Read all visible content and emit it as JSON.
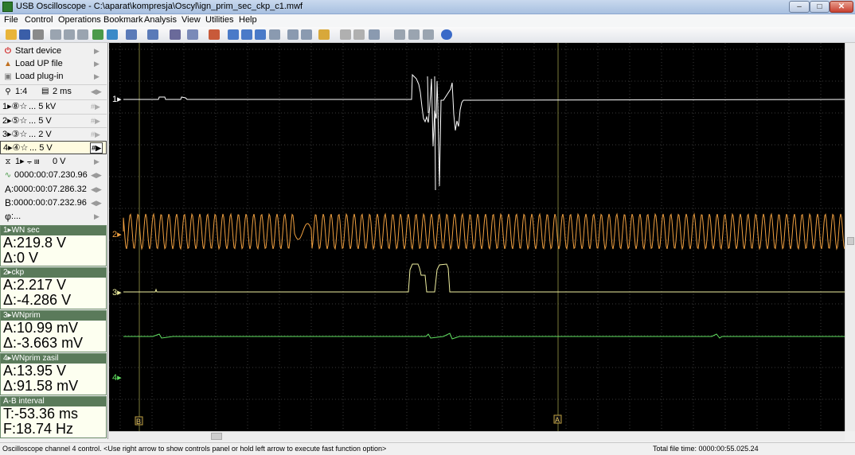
{
  "window": {
    "title": "USB Oscilloscope - C:\\aparat\\kompresja\\Oscyl\\ign_prim_sec_ckp_c1.mwf"
  },
  "menu": [
    "File",
    "Control",
    "Operations",
    "Bookmark",
    "Analysis",
    "View",
    "Utilities",
    "Help"
  ],
  "left_panel": {
    "start_device": "Start device",
    "load_up_file": "Load UP file",
    "load_plugin": "Load plug-in",
    "zoom": "1:4",
    "timebase": "2 ms",
    "channels": [
      {
        "num": "1",
        "label": "... 5 kV"
      },
      {
        "num": "2",
        "label": "... 5 V"
      },
      {
        "num": "3",
        "label": "... 2 V"
      },
      {
        "num": "4",
        "label": "... 5 V"
      }
    ],
    "trigger": "1",
    "trigger_level": "0 V",
    "time": "0000:00:07.230.96",
    "cursor_a": "0000:00:07.286.32",
    "cursor_b": "0000:00:07.232.96",
    "phi": "..."
  },
  "measurements": [
    {
      "title": "1▸WN sec",
      "a": "A:219.8 V",
      "delta": "Δ:0 V"
    },
    {
      "title": "2▸ckp",
      "a": "A:2.217 V",
      "delta": "Δ:-4.286 V"
    },
    {
      "title": "3▸WNprim",
      "a": "A:10.99 mV",
      "delta": "Δ:-3.663 mV"
    },
    {
      "title": "4▸WNprim zasil",
      "a": "A:13.95 V",
      "delta": "Δ:91.58 mV"
    }
  ],
  "interval": {
    "title": "A-B interval",
    "t": "T:-53.36 ms",
    "f": "F:18.74 Hz"
  },
  "plot": {
    "channel_markers": [
      "1▸",
      "2▸",
      "3▸",
      "4▸"
    ],
    "marker_a": "A",
    "marker_b": "B",
    "colors": {
      "ch1": "#ffffff",
      "ch2": "#f0a040",
      "ch3": "#f0f0a0",
      "ch4": "#60e060",
      "grid": "#3a3a3a",
      "cursor": "#8a8a4a"
    }
  },
  "status": {
    "left": "Oscilloscope channel 4 control. <Use right arrow to show controls panel or hold left arrow to execute fast function option>",
    "right": "Total file time: 0000:00:55.025.24"
  }
}
